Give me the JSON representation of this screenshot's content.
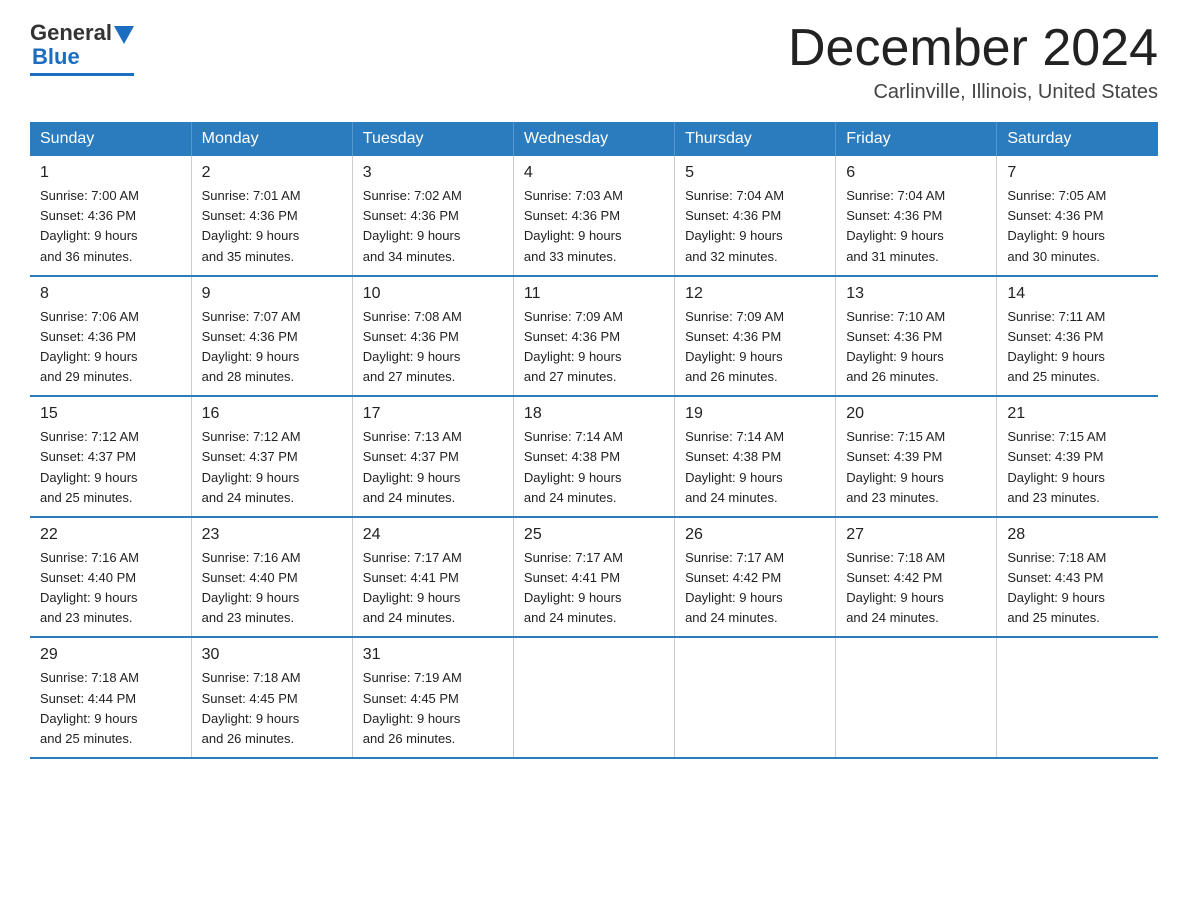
{
  "logo": {
    "general": "General",
    "blue": "Blue"
  },
  "header": {
    "month_title": "December 2024",
    "location": "Carlinville, Illinois, United States"
  },
  "days_of_week": [
    "Sunday",
    "Monday",
    "Tuesday",
    "Wednesday",
    "Thursday",
    "Friday",
    "Saturday"
  ],
  "weeks": [
    [
      {
        "day": "1",
        "sunrise": "7:00 AM",
        "sunset": "4:36 PM",
        "daylight": "9 hours and 36 minutes."
      },
      {
        "day": "2",
        "sunrise": "7:01 AM",
        "sunset": "4:36 PM",
        "daylight": "9 hours and 35 minutes."
      },
      {
        "day": "3",
        "sunrise": "7:02 AM",
        "sunset": "4:36 PM",
        "daylight": "9 hours and 34 minutes."
      },
      {
        "day": "4",
        "sunrise": "7:03 AM",
        "sunset": "4:36 PM",
        "daylight": "9 hours and 33 minutes."
      },
      {
        "day": "5",
        "sunrise": "7:04 AM",
        "sunset": "4:36 PM",
        "daylight": "9 hours and 32 minutes."
      },
      {
        "day": "6",
        "sunrise": "7:04 AM",
        "sunset": "4:36 PM",
        "daylight": "9 hours and 31 minutes."
      },
      {
        "day": "7",
        "sunrise": "7:05 AM",
        "sunset": "4:36 PM",
        "daylight": "9 hours and 30 minutes."
      }
    ],
    [
      {
        "day": "8",
        "sunrise": "7:06 AM",
        "sunset": "4:36 PM",
        "daylight": "9 hours and 29 minutes."
      },
      {
        "day": "9",
        "sunrise": "7:07 AM",
        "sunset": "4:36 PM",
        "daylight": "9 hours and 28 minutes."
      },
      {
        "day": "10",
        "sunrise": "7:08 AM",
        "sunset": "4:36 PM",
        "daylight": "9 hours and 27 minutes."
      },
      {
        "day": "11",
        "sunrise": "7:09 AM",
        "sunset": "4:36 PM",
        "daylight": "9 hours and 27 minutes."
      },
      {
        "day": "12",
        "sunrise": "7:09 AM",
        "sunset": "4:36 PM",
        "daylight": "9 hours and 26 minutes."
      },
      {
        "day": "13",
        "sunrise": "7:10 AM",
        "sunset": "4:36 PM",
        "daylight": "9 hours and 26 minutes."
      },
      {
        "day": "14",
        "sunrise": "7:11 AM",
        "sunset": "4:36 PM",
        "daylight": "9 hours and 25 minutes."
      }
    ],
    [
      {
        "day": "15",
        "sunrise": "7:12 AM",
        "sunset": "4:37 PM",
        "daylight": "9 hours and 25 minutes."
      },
      {
        "day": "16",
        "sunrise": "7:12 AM",
        "sunset": "4:37 PM",
        "daylight": "9 hours and 24 minutes."
      },
      {
        "day": "17",
        "sunrise": "7:13 AM",
        "sunset": "4:37 PM",
        "daylight": "9 hours and 24 minutes."
      },
      {
        "day": "18",
        "sunrise": "7:14 AM",
        "sunset": "4:38 PM",
        "daylight": "9 hours and 24 minutes."
      },
      {
        "day": "19",
        "sunrise": "7:14 AM",
        "sunset": "4:38 PM",
        "daylight": "9 hours and 24 minutes."
      },
      {
        "day": "20",
        "sunrise": "7:15 AM",
        "sunset": "4:39 PM",
        "daylight": "9 hours and 23 minutes."
      },
      {
        "day": "21",
        "sunrise": "7:15 AM",
        "sunset": "4:39 PM",
        "daylight": "9 hours and 23 minutes."
      }
    ],
    [
      {
        "day": "22",
        "sunrise": "7:16 AM",
        "sunset": "4:40 PM",
        "daylight": "9 hours and 23 minutes."
      },
      {
        "day": "23",
        "sunrise": "7:16 AM",
        "sunset": "4:40 PM",
        "daylight": "9 hours and 23 minutes."
      },
      {
        "day": "24",
        "sunrise": "7:17 AM",
        "sunset": "4:41 PM",
        "daylight": "9 hours and 24 minutes."
      },
      {
        "day": "25",
        "sunrise": "7:17 AM",
        "sunset": "4:41 PM",
        "daylight": "9 hours and 24 minutes."
      },
      {
        "day": "26",
        "sunrise": "7:17 AM",
        "sunset": "4:42 PM",
        "daylight": "9 hours and 24 minutes."
      },
      {
        "day": "27",
        "sunrise": "7:18 AM",
        "sunset": "4:42 PM",
        "daylight": "9 hours and 24 minutes."
      },
      {
        "day": "28",
        "sunrise": "7:18 AM",
        "sunset": "4:43 PM",
        "daylight": "9 hours and 25 minutes."
      }
    ],
    [
      {
        "day": "29",
        "sunrise": "7:18 AM",
        "sunset": "4:44 PM",
        "daylight": "9 hours and 25 minutes."
      },
      {
        "day": "30",
        "sunrise": "7:18 AM",
        "sunset": "4:45 PM",
        "daylight": "9 hours and 26 minutes."
      },
      {
        "day": "31",
        "sunrise": "7:19 AM",
        "sunset": "4:45 PM",
        "daylight": "9 hours and 26 minutes."
      },
      null,
      null,
      null,
      null
    ]
  ],
  "labels": {
    "sunrise": "Sunrise:",
    "sunset": "Sunset:",
    "daylight": "Daylight:"
  },
  "colors": {
    "header_bg": "#2b7bbf",
    "header_text": "#ffffff",
    "border": "#2b7bbf",
    "logo_blue": "#1a6dbf"
  }
}
